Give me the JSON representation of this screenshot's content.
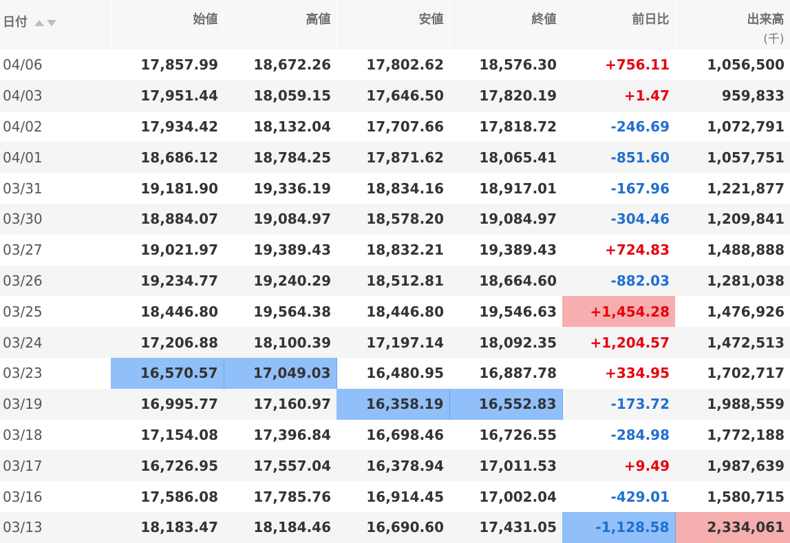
{
  "headers": {
    "date": "日付",
    "open": "始値",
    "high": "高値",
    "low": "安値",
    "close": "終値",
    "change": "前日比",
    "volume": "出来高",
    "volume_unit": "(千)"
  },
  "rows": [
    {
      "date": "04/06",
      "open": "17,857.99",
      "high": "18,672.26",
      "low": "17,802.62",
      "close": "18,576.30",
      "change": "+756.11",
      "volume": "1,056,500"
    },
    {
      "date": "04/03",
      "open": "17,951.44",
      "high": "18,059.15",
      "low": "17,646.50",
      "close": "17,820.19",
      "change": "+1.47",
      "volume": "959,833"
    },
    {
      "date": "04/02",
      "open": "17,934.42",
      "high": "18,132.04",
      "low": "17,707.66",
      "close": "17,818.72",
      "change": "-246.69",
      "volume": "1,072,791"
    },
    {
      "date": "04/01",
      "open": "18,686.12",
      "high": "18,784.25",
      "low": "17,871.62",
      "close": "18,065.41",
      "change": "-851.60",
      "volume": "1,057,751"
    },
    {
      "date": "03/31",
      "open": "19,181.90",
      "high": "19,336.19",
      "low": "18,834.16",
      "close": "18,917.01",
      "change": "-167.96",
      "volume": "1,221,877"
    },
    {
      "date": "03/30",
      "open": "18,884.07",
      "high": "19,084.97",
      "low": "18,578.20",
      "close": "19,084.97",
      "change": "-304.46",
      "volume": "1,209,841"
    },
    {
      "date": "03/27",
      "open": "19,021.97",
      "high": "19,389.43",
      "low": "18,832.21",
      "close": "19,389.43",
      "change": "+724.83",
      "volume": "1,488,888"
    },
    {
      "date": "03/26",
      "open": "19,234.77",
      "high": "19,240.29",
      "low": "18,512.81",
      "close": "18,664.60",
      "change": "-882.03",
      "volume": "1,281,038"
    },
    {
      "date": "03/25",
      "open": "18,446.80",
      "high": "19,564.38",
      "low": "18,446.80",
      "close": "19,546.63",
      "change": "+1,454.28",
      "volume": "1,476,926"
    },
    {
      "date": "03/24",
      "open": "17,206.88",
      "high": "18,100.39",
      "low": "17,197.14",
      "close": "18,092.35",
      "change": "+1,204.57",
      "volume": "1,472,513"
    },
    {
      "date": "03/23",
      "open": "16,570.57",
      "high": "17,049.03",
      "low": "16,480.95",
      "close": "16,887.78",
      "change": "+334.95",
      "volume": "1,702,717"
    },
    {
      "date": "03/19",
      "open": "16,995.77",
      "high": "17,160.97",
      "low": "16,358.19",
      "close": "16,552.83",
      "change": "-173.72",
      "volume": "1,988,559"
    },
    {
      "date": "03/18",
      "open": "17,154.08",
      "high": "17,396.84",
      "low": "16,698.46",
      "close": "16,726.55",
      "change": "-284.98",
      "volume": "1,772,188"
    },
    {
      "date": "03/17",
      "open": "16,726.95",
      "high": "17,557.04",
      "low": "16,378.94",
      "close": "17,011.53",
      "change": "+9.49",
      "volume": "1,987,639"
    },
    {
      "date": "03/16",
      "open": "17,586.08",
      "high": "17,785.76",
      "low": "16,914.45",
      "close": "17,002.04",
      "change": "-429.01",
      "volume": "1,580,715"
    },
    {
      "date": "03/13",
      "open": "18,183.47",
      "high": "18,184.46",
      "low": "16,690.60",
      "close": "17,431.05",
      "change": "-1,128.58",
      "volume": "2,334,061"
    }
  ],
  "highlights": {
    "blue": [
      "10.open",
      "10.high",
      "11.low",
      "11.close",
      "15.change"
    ],
    "red": [
      "8.change",
      "15.volume"
    ]
  },
  "colors": {
    "positive": "#e8000d",
    "negative": "#1f6fd0",
    "highlight_blue": "#91bff9",
    "highlight_red": "#f7aeae"
  }
}
